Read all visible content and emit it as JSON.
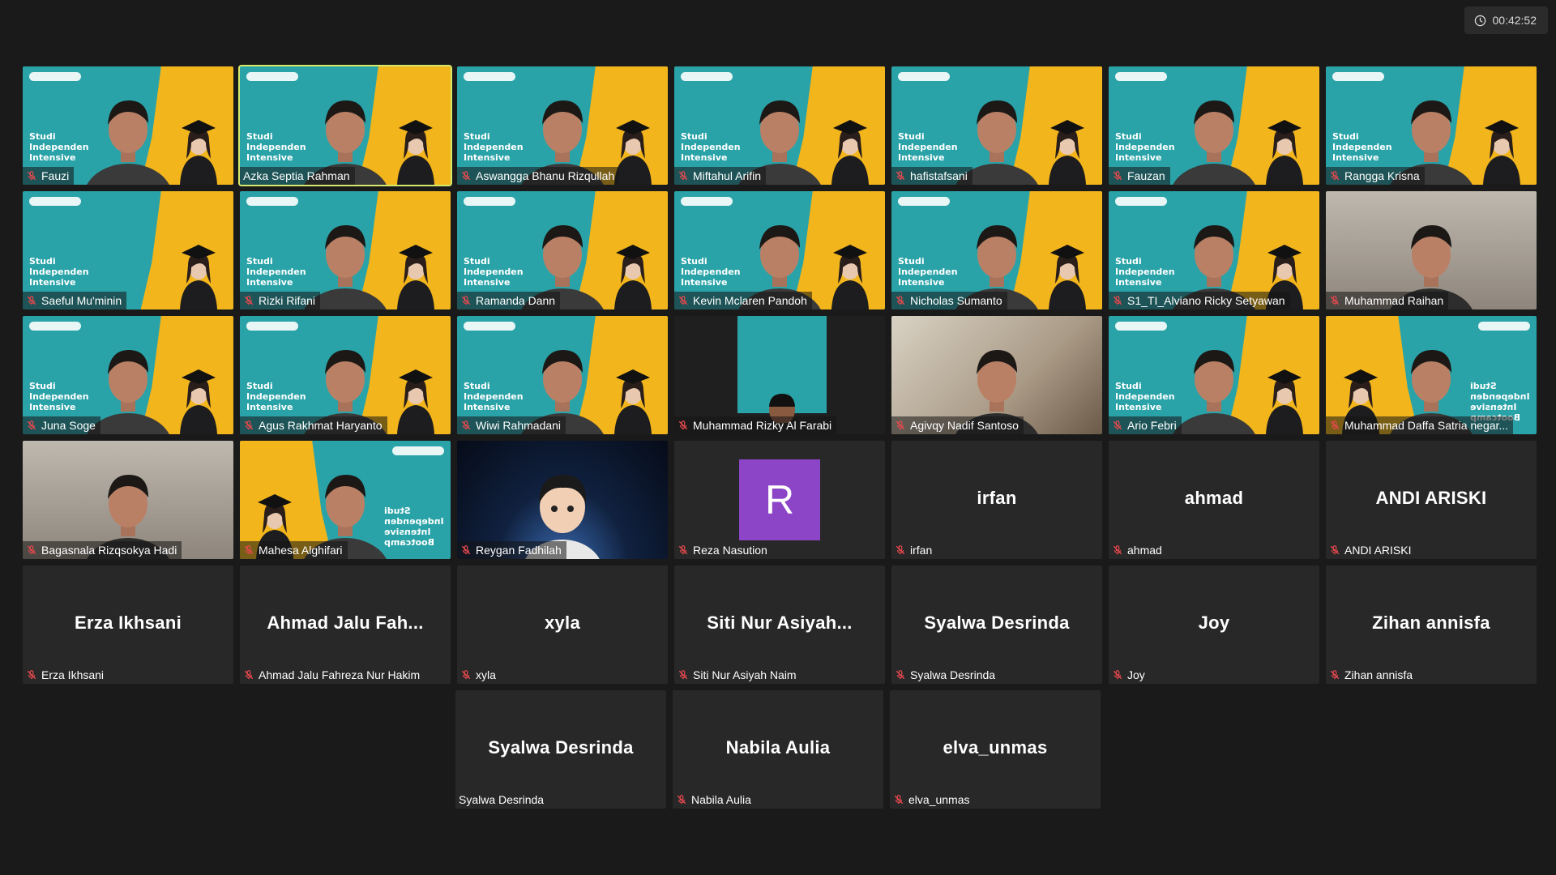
{
  "timer": {
    "elapsed": "00:42:52"
  },
  "promo_text": [
    "Studi",
    "Independen",
    "Intensive"
  ],
  "promo_text_flipped": [
    "Studi",
    "Independen",
    "Intensive",
    "Bootcamp"
  ],
  "colors": {
    "teal": "#2aa3a8",
    "yellow": "#f2b51c",
    "tile_bg": "#282828",
    "speaking_border": "#d6e86a",
    "avatar_purple": "#8b45c6"
  },
  "rows": [
    [
      {
        "name": "Fauzi",
        "bg": "teal",
        "muted": true
      },
      {
        "name": "Azka Septia Rahman",
        "bg": "teal",
        "muted": false,
        "speaking": true
      },
      {
        "name": "Aswangga Bhanu Rizqullah",
        "bg": "teal",
        "muted": true
      },
      {
        "name": "Miftahul Arifin",
        "bg": "teal",
        "muted": true
      },
      {
        "name": "hafistafsani",
        "bg": "teal",
        "muted": true
      },
      {
        "name": "Fauzan",
        "bg": "teal",
        "muted": true
      },
      {
        "name": "Rangga Krisna",
        "bg": "teal",
        "muted": true
      }
    ],
    [
      {
        "name": "Saeful Mu'minin",
        "bg": "teal",
        "muted": true,
        "noperson": true
      },
      {
        "name": "Rizki Rifani",
        "bg": "teal",
        "muted": true
      },
      {
        "name": "Ramanda Dann",
        "bg": "teal",
        "muted": true
      },
      {
        "name": "Kevin Mclaren Pandoh",
        "bg": "teal",
        "muted": true
      },
      {
        "name": "Nicholas Sumanto",
        "bg": "teal",
        "muted": true
      },
      {
        "name": "S1_TI_Alviano Ricky Setyawan",
        "bg": "teal",
        "muted": true
      },
      {
        "name": "Muhammad Raihan",
        "bg": "room",
        "muted": true
      }
    ],
    [
      {
        "name": "Juna Soge",
        "bg": "teal",
        "muted": true
      },
      {
        "name": "Agus Rakhmat Haryanto",
        "bg": "teal",
        "muted": true
      },
      {
        "name": "Wiwi Rahmadani",
        "bg": "teal",
        "muted": true
      },
      {
        "name": "Muhammad Rizky Al Farabi",
        "bg": "dark",
        "muted": true
      },
      {
        "name": "Agivqy Nadif Santoso",
        "bg": "room2",
        "muted": true
      },
      {
        "name": "Ario Febri",
        "bg": "teal",
        "muted": true
      },
      {
        "name": "Muhammad Daffa Satria negar...",
        "bg": "flip",
        "muted": true
      }
    ],
    [
      {
        "name": "Bagasnala Rizqsokya Hadi",
        "bg": "room",
        "muted": true
      },
      {
        "name": "Mahesa Alghifari",
        "bg": "flip",
        "muted": true
      },
      {
        "name": "Reygan Fadhilah",
        "bg": "space",
        "muted": true
      },
      {
        "name": "Reza Nasution",
        "bg": "avatar",
        "initial": "R",
        "muted": true
      },
      {
        "name": "irfan",
        "bg": "none",
        "display": "irfan",
        "muted": true
      },
      {
        "name": "ahmad",
        "bg": "none",
        "display": "ahmad",
        "muted": true
      },
      {
        "name": "ANDI ARISKI",
        "bg": "none",
        "display": "ANDI ARISKI",
        "muted": true
      }
    ],
    [
      {
        "name": "Erza Ikhsani",
        "bg": "none",
        "display": "Erza Ikhsani",
        "muted": true
      },
      {
        "name": "Ahmad Jalu Fahreza Nur Hakim",
        "bg": "none",
        "display": "Ahmad Jalu Fah...",
        "muted": true
      },
      {
        "name": "xyla",
        "bg": "none",
        "display": "xyla",
        "muted": true
      },
      {
        "name": "Siti Nur Asiyah Naim",
        "bg": "none",
        "display": "Siti Nur Asiyah...",
        "muted": true
      },
      {
        "name": "Syalwa Desrinda",
        "bg": "none",
        "display": "Syalwa Desrinda",
        "muted": true
      },
      {
        "name": "Joy",
        "bg": "none",
        "display": "Joy",
        "muted": true
      },
      {
        "name": "Zihan annisfa",
        "bg": "none",
        "display": "Zihan annisfa",
        "muted": true
      }
    ],
    [
      {
        "name": "Syalwa Desrinda",
        "bg": "none",
        "display": "Syalwa Desrinda",
        "muted": false
      },
      {
        "name": "Nabila Aulia",
        "bg": "none",
        "display": "Nabila Aulia",
        "muted": true
      },
      {
        "name": "elva_unmas",
        "bg": "none",
        "display": "elva_unmas",
        "muted": true
      }
    ]
  ]
}
